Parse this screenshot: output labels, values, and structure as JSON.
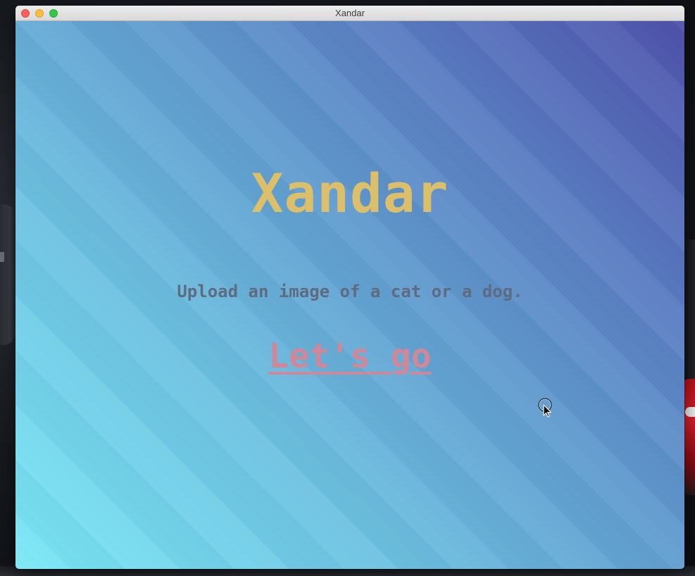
{
  "window": {
    "title": "Xandar"
  },
  "main": {
    "heading": "Xandar",
    "subtitle": "Upload an image of a cat or a dog.",
    "cta_label": "Let's go"
  },
  "colors": {
    "heading": "#dbbf6a",
    "subtitle": "#5e6b80",
    "cta": "#cf8799",
    "gradient_start": "#7ae8f6",
    "gradient_end": "#4f52ac"
  },
  "icons": {
    "cursor": "pointer-cursor-icon"
  }
}
